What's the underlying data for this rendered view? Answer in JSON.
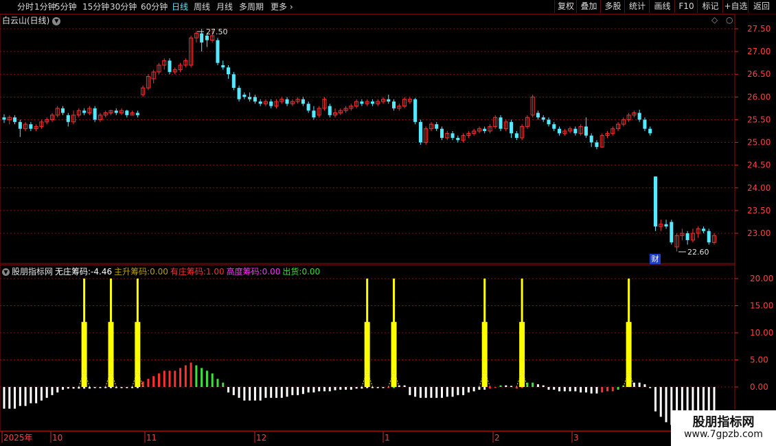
{
  "toolbar": {
    "periods": [
      {
        "label": "分时",
        "active": false
      },
      {
        "label": "1分钟",
        "active": false
      },
      {
        "label": "5分钟",
        "active": false
      },
      {
        "label": "15分钟",
        "active": false
      },
      {
        "label": "30分钟",
        "active": false
      },
      {
        "label": "60分钟",
        "active": false
      },
      {
        "label": "日线",
        "active": true
      },
      {
        "label": "周线",
        "active": false
      },
      {
        "label": "月线",
        "active": false
      },
      {
        "label": "多周期",
        "active": false
      },
      {
        "label": "更多",
        "active": false
      }
    ],
    "more_arrow": "›",
    "right_buttons": [
      "复权",
      "叠加",
      "多股",
      "统计",
      "画线",
      "F10",
      "标记",
      "+自选",
      "返回"
    ]
  },
  "stock": {
    "title": "白云山(日线)",
    "dropdown_icon": "chevron-down-icon"
  },
  "price_axis": {
    "ticks": [
      "27.50",
      "27.00",
      "26.50",
      "26.00",
      "25.50",
      "25.00",
      "24.50",
      "24.00",
      "23.50",
      "23.00"
    ]
  },
  "annotations": {
    "high_label": "27.50",
    "low_label": "22.60",
    "event_badge": "财"
  },
  "indicator": {
    "name": "股朋指标网",
    "items": [
      {
        "label": "无庄筹码:",
        "value": "-4.46",
        "color": "#ffffff"
      },
      {
        "label": "主升筹码:",
        "value": "0.00",
        "color": "#b8a000"
      },
      {
        "label": "有庄筹码:",
        "value": "1.00",
        "color": "#ff3030"
      },
      {
        "label": "高度筹码:",
        "value": "0.00",
        "color": "#ff30ff"
      },
      {
        "label": "出货:",
        "value": "0.00",
        "color": "#30e030"
      }
    ],
    "axis_ticks": [
      "20.00",
      "15.00",
      "10.00",
      "5.00",
      "0.00"
    ]
  },
  "time_axis": {
    "labels": [
      "2025年",
      "10",
      "11",
      "12",
      "1",
      "2",
      "3"
    ]
  },
  "watermark": {
    "line1": "股朋指标网",
    "line2": "www.7gpzb.com"
  },
  "colors": {
    "up": "#ff3030",
    "down": "#55e8ff",
    "grid": "#8a0f0f",
    "spike": "#ffff00",
    "accent": "#4de8ff"
  },
  "chart_data": {
    "type": "candlestick",
    "price_range": [
      22.45,
      27.7
    ],
    "candles": [
      [
        25.55,
        25.5,
        25.62,
        25.43
      ],
      [
        25.5,
        25.55,
        25.6,
        25.4
      ],
      [
        25.55,
        25.45,
        25.6,
        25.4
      ],
      [
        25.45,
        25.3,
        25.5,
        25.12
      ],
      [
        25.3,
        25.4,
        25.45,
        25.25
      ],
      [
        25.4,
        25.3,
        25.45,
        25.25
      ],
      [
        25.3,
        25.35,
        25.4,
        25.25
      ],
      [
        25.35,
        25.45,
        25.5,
        25.3
      ],
      [
        25.45,
        25.5,
        25.55,
        25.4
      ],
      [
        25.5,
        25.6,
        25.65,
        25.45
      ],
      [
        25.6,
        25.75,
        25.8,
        25.55
      ],
      [
        25.75,
        25.65,
        25.8,
        25.6
      ],
      [
        25.6,
        25.45,
        25.65,
        25.35
      ],
      [
        25.45,
        25.6,
        25.7,
        25.4
      ],
      [
        25.6,
        25.7,
        25.75,
        25.55
      ],
      [
        25.7,
        25.65,
        25.75,
        25.6
      ],
      [
        25.65,
        25.75,
        25.8,
        25.6
      ],
      [
        25.75,
        25.5,
        25.8,
        25.45
      ],
      [
        25.5,
        25.6,
        25.65,
        25.45
      ],
      [
        25.6,
        25.65,
        25.7,
        25.55
      ],
      [
        25.65,
        25.7,
        25.72,
        25.6
      ],
      [
        25.7,
        25.65,
        25.75,
        25.6
      ],
      [
        25.65,
        25.7,
        25.75,
        25.6
      ],
      [
        25.7,
        25.6,
        25.72,
        25.55
      ],
      [
        25.6,
        25.65,
        25.7,
        25.6
      ],
      [
        25.65,
        25.6,
        25.7,
        25.55
      ],
      [
        26.05,
        26.2,
        26.25,
        26.0
      ],
      [
        26.2,
        26.45,
        26.5,
        26.15
      ],
      [
        26.4,
        26.55,
        26.6,
        26.3
      ],
      [
        26.55,
        26.7,
        26.75,
        26.5
      ],
      [
        26.7,
        26.8,
        26.85,
        26.6
      ],
      [
        26.8,
        26.55,
        26.85,
        26.5
      ],
      [
        26.55,
        26.6,
        26.65,
        26.5
      ],
      [
        26.6,
        26.7,
        26.75,
        26.55
      ],
      [
        26.7,
        26.8,
        26.85,
        26.65
      ],
      [
        26.7,
        27.3,
        27.35,
        26.65
      ],
      [
        27.3,
        27.4,
        27.45,
        27.2
      ],
      [
        27.4,
        27.2,
        27.5,
        27.0
      ],
      [
        27.35,
        27.25,
        27.4,
        27.1
      ],
      [
        27.25,
        27.35,
        27.5,
        27.2
      ],
      [
        27.25,
        26.75,
        27.3,
        26.7
      ],
      [
        26.7,
        26.65,
        26.8,
        26.6
      ],
      [
        26.65,
        26.5,
        26.7,
        26.4
      ],
      [
        26.5,
        26.2,
        26.55,
        26.15
      ],
      [
        26.2,
        25.95,
        26.25,
        25.9
      ],
      [
        26.05,
        26.0,
        26.1,
        25.95
      ],
      [
        26.0,
        25.95,
        26.1,
        25.9
      ],
      [
        26.0,
        25.9,
        26.05,
        25.85
      ],
      [
        25.9,
        25.85,
        25.95,
        25.8
      ],
      [
        25.85,
        25.9,
        25.95,
        25.8
      ],
      [
        25.9,
        25.8,
        25.95,
        25.75
      ],
      [
        25.8,
        25.9,
        25.95,
        25.75
      ],
      [
        25.9,
        25.95,
        26.0,
        25.85
      ],
      [
        25.95,
        25.85,
        26.0,
        25.8
      ],
      [
        25.85,
        25.9,
        25.95,
        25.8
      ],
      [
        25.9,
        25.95,
        26.0,
        25.85
      ],
      [
        25.95,
        25.85,
        26.0,
        25.8
      ],
      [
        25.85,
        25.7,
        25.9,
        25.65
      ],
      [
        25.7,
        25.55,
        25.8,
        25.5
      ],
      [
        25.6,
        25.75,
        25.8,
        25.55
      ],
      [
        25.75,
        25.95,
        26.0,
        25.7
      ],
      [
        25.8,
        25.6,
        25.85,
        25.55
      ],
      [
        25.6,
        25.65,
        25.75,
        25.55
      ],
      [
        25.65,
        25.7,
        25.75,
        25.6
      ],
      [
        25.7,
        25.75,
        25.8,
        25.65
      ],
      [
        25.75,
        25.8,
        25.85,
        25.7
      ],
      [
        25.8,
        25.9,
        25.95,
        25.75
      ],
      [
        25.9,
        25.85,
        25.95,
        25.8
      ],
      [
        25.85,
        25.9,
        25.95,
        25.8
      ],
      [
        25.9,
        25.85,
        25.95,
        25.8
      ],
      [
        25.85,
        25.9,
        25.95,
        25.8
      ],
      [
        25.9,
        25.95,
        26.0,
        25.85
      ],
      [
        25.95,
        25.9,
        26.05,
        25.85
      ],
      [
        25.9,
        25.75,
        25.95,
        25.7
      ],
      [
        25.75,
        25.8,
        25.85,
        25.7
      ],
      [
        25.8,
        25.95,
        26.0,
        25.75
      ],
      [
        25.9,
        25.95,
        26.0,
        25.85
      ],
      [
        25.95,
        25.45,
        25.98,
        25.4
      ],
      [
        25.45,
        25.0,
        25.5,
        24.95
      ],
      [
        25.0,
        25.3,
        25.35,
        24.95
      ],
      [
        25.3,
        25.4,
        25.45,
        25.25
      ],
      [
        25.4,
        25.3,
        25.45,
        25.25
      ],
      [
        25.3,
        25.1,
        25.35,
        25.05
      ],
      [
        25.1,
        25.2,
        25.25,
        25.05
      ],
      [
        25.2,
        25.1,
        25.25,
        25.05
      ],
      [
        25.1,
        25.05,
        25.15,
        25.0
      ],
      [
        25.05,
        25.15,
        25.2,
        25.0
      ],
      [
        25.15,
        25.2,
        25.25,
        25.1
      ],
      [
        25.2,
        25.25,
        25.3,
        25.15
      ],
      [
        25.25,
        25.3,
        25.35,
        25.2
      ],
      [
        25.3,
        25.25,
        25.35,
        25.2
      ],
      [
        25.25,
        25.35,
        25.4,
        25.2
      ],
      [
        25.35,
        25.55,
        25.6,
        25.3
      ],
      [
        25.55,
        25.3,
        25.6,
        25.25
      ],
      [
        25.3,
        25.45,
        25.5,
        25.25
      ],
      [
        25.45,
        25.2,
        25.5,
        25.1
      ],
      [
        25.2,
        25.1,
        25.25,
        25.05
      ],
      [
        25.1,
        25.35,
        25.4,
        25.05
      ],
      [
        25.35,
        25.55,
        25.6,
        25.3
      ],
      [
        25.6,
        26.0,
        26.05,
        25.55
      ],
      [
        25.65,
        25.55,
        25.7,
        25.5
      ],
      [
        25.55,
        25.5,
        25.6,
        25.45
      ],
      [
        25.5,
        25.4,
        25.55,
        25.35
      ],
      [
        25.4,
        25.3,
        25.45,
        25.25
      ],
      [
        25.3,
        25.2,
        25.35,
        25.15
      ],
      [
        25.2,
        25.25,
        25.3,
        25.15
      ],
      [
        25.25,
        25.3,
        25.35,
        25.2
      ],
      [
        25.3,
        25.2,
        25.35,
        25.15
      ],
      [
        25.2,
        25.35,
        25.4,
        25.15
      ],
      [
        25.35,
        25.15,
        25.55,
        25.1
      ],
      [
        25.15,
        25.0,
        25.2,
        24.9
      ],
      [
        25.0,
        24.9,
        25.05,
        24.85
      ],
      [
        24.9,
        25.15,
        25.2,
        24.88
      ],
      [
        25.15,
        25.2,
        25.25,
        25.1
      ],
      [
        25.2,
        25.3,
        25.35,
        25.15
      ],
      [
        25.3,
        25.4,
        25.45,
        25.25
      ],
      [
        25.4,
        25.5,
        25.55,
        25.35
      ],
      [
        25.5,
        25.6,
        25.65,
        25.45
      ],
      [
        25.6,
        25.65,
        25.7,
        25.55
      ],
      [
        25.65,
        25.5,
        25.72,
        25.45
      ],
      [
        25.5,
        25.3,
        25.55,
        25.25
      ],
      [
        25.3,
        25.2,
        25.35,
        25.15
      ],
      [
        24.25,
        23.15,
        24.25,
        23.05
      ],
      [
        23.15,
        23.2,
        23.3,
        23.05
      ],
      [
        23.2,
        23.15,
        23.3,
        23.1
      ],
      [
        23.25,
        22.8,
        23.3,
        22.75
      ],
      [
        22.7,
        22.95,
        23.0,
        22.6
      ],
      [
        22.95,
        23.0,
        23.1,
        22.85
      ],
      [
        23.0,
        22.85,
        23.05,
        22.75
      ],
      [
        22.85,
        23.0,
        23.1,
        22.8
      ],
      [
        23.0,
        23.1,
        23.15,
        22.9
      ],
      [
        23.1,
        23.05,
        23.15,
        23.0
      ],
      [
        23.05,
        22.8,
        23.1,
        22.75
      ],
      [
        22.8,
        22.95,
        23.0,
        22.75
      ]
    ],
    "indicator_bars": {
      "range": [
        -7.5,
        21.5
      ],
      "spike_value": 20.0,
      "spike_body_value": 12.0,
      "spike_index": [
        15,
        20,
        25,
        68,
        73,
        90,
        97,
        117
      ],
      "values": [
        -4.0,
        -4.0,
        -4.0,
        -3.5,
        -3.5,
        -3.0,
        -3.0,
        -2.5,
        -2.0,
        -1.5,
        -1.0,
        -0.5,
        -0.3,
        -0.3,
        -0.3,
        -0.3,
        -0.3,
        -0.2,
        -0.2,
        -0.2,
        -0.2,
        -0.2,
        -0.2,
        -0.2,
        -0.2,
        -0.2,
        1.0,
        1.5,
        2.0,
        2.5,
        3.0,
        3.0,
        3.0,
        3.5,
        4.0,
        4.5,
        4.0,
        3.5,
        3.0,
        2.5,
        1.5,
        0.8,
        -1.0,
        -1.5,
        -2.0,
        -2.5,
        -2.5,
        -2.5,
        -2.5,
        -2.0,
        -2.0,
        -2.0,
        -2.0,
        -1.8,
        -1.5,
        -1.5,
        -1.3,
        -1.0,
        -1.0,
        -0.8,
        -0.8,
        -0.8,
        -0.6,
        -0.5,
        -0.5,
        -0.5,
        -0.3,
        -0.3,
        -0.2,
        -0.2,
        -0.2,
        -0.2,
        -0.2,
        -0.2,
        0.3,
        0.3,
        -1.5,
        -1.8,
        -2.0,
        -2.0,
        -2.0,
        -2.0,
        -2.0,
        -1.8,
        -1.8,
        -1.5,
        -1.5,
        -1.0,
        -0.8,
        -0.5,
        -0.5,
        -0.3,
        0.0,
        0.3,
        0.3,
        0.2,
        -0.3,
        -0.2,
        0.8,
        0.8,
        0.5,
        0.3,
        -0.5,
        -0.5,
        -0.8,
        -0.8,
        -0.8,
        -0.8,
        -1.0,
        -1.0,
        -1.2,
        -1.2,
        -1.0,
        -0.8,
        -0.8,
        -0.5,
        0.3,
        0.5,
        0.8,
        0.8,
        0.5,
        -0.2,
        -4.5,
        -5.5,
        -6.5,
        -7.0,
        -5.0,
        -5.0,
        -5.0,
        -5.0,
        -5.0,
        -5.0,
        -5.0,
        -5.0
      ],
      "colors": [
        "white",
        "white",
        "white",
        "white",
        "white",
        "white",
        "white",
        "white",
        "white",
        "white",
        "white",
        "white",
        "white",
        "white",
        "white",
        "white",
        "white",
        "white",
        "white",
        "white",
        "white",
        "white",
        "white",
        "white",
        "white",
        "white",
        "red",
        "red",
        "red",
        "red",
        "red",
        "red",
        "red",
        "red",
        "red",
        "red",
        "green",
        "green",
        "green",
        "green",
        "green",
        "green",
        "white",
        "white",
        "white",
        "white",
        "white",
        "white",
        "white",
        "white",
        "white",
        "white",
        "white",
        "white",
        "white",
        "white",
        "white",
        "white",
        "white",
        "white",
        "white",
        "white",
        "white",
        "white",
        "white",
        "white",
        "white",
        "white",
        "white",
        "white",
        "white",
        "white",
        "red",
        "green",
        "white",
        "white",
        "white",
        "white",
        "white",
        "white",
        "white",
        "white",
        "white",
        "white",
        "white",
        "white",
        "white",
        "white",
        "white",
        "white",
        "white",
        "red",
        "red",
        "green",
        "white",
        "white",
        "red",
        "red",
        "green",
        "green",
        "white",
        "white",
        "white",
        "white",
        "white",
        "white",
        "white",
        "white",
        "white",
        "white",
        "white",
        "white",
        "red",
        "red",
        "red",
        "green",
        "green",
        "white",
        "white",
        "white",
        "white",
        "white",
        "white",
        "white",
        "white",
        "white",
        "white",
        "white",
        "white",
        "white"
      ]
    },
    "x_labels": [
      "2025年",
      "10",
      "11",
      "12",
      "1",
      "2",
      "3"
    ]
  }
}
